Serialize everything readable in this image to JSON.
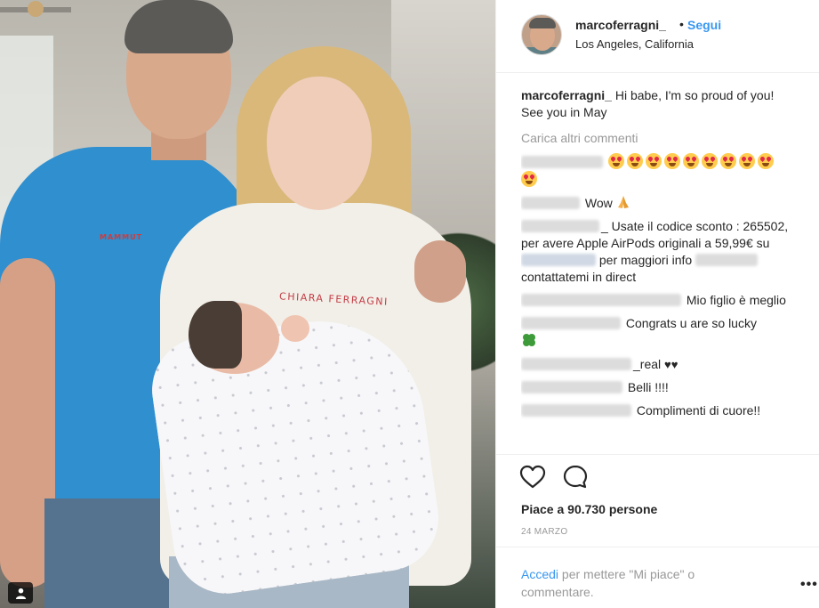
{
  "post": {
    "shirt_logo": "MAMMUT",
    "hoodie_text": "CHIARA FERRAGNI"
  },
  "header": {
    "username": "marcoferragni_",
    "separator": "•",
    "follow_label": "Segui",
    "location": "Los Angeles, California"
  },
  "caption": {
    "username": "marcoferragni_",
    "text": "Hi babe, I'm so proud of you! See you in May"
  },
  "load_more_label": "Carica altri commenti",
  "comments": [
    {
      "text": ""
    },
    {
      "text": "Wow"
    },
    {
      "text_a": "_ Usate il codice sconto : 265502, per avere Apple AirPods originali a 59,99€ su",
      "text_b": "per maggiori info",
      "text_c": "contattatemi in direct"
    },
    {
      "text": "Mio figlio è meglio"
    },
    {
      "text": "Congrats u are so lucky"
    },
    {
      "text": "_real"
    },
    {
      "text": "Belli !!!!"
    },
    {
      "text": "Complimenti di cuore!!"
    }
  ],
  "likes_label": "Piace a 90.730 persone",
  "date_label": "24 MARZO",
  "login": {
    "link_label": "Accedi",
    "rest": " per mettere \"Mi piace\" o commentare."
  },
  "more_label": "•••",
  "icons": {
    "heart": "heart-outline-icon",
    "comment": "speech-bubble-icon",
    "user_tag": "person-icon"
  },
  "colors": {
    "link_blue": "#3897f0",
    "text": "#262626",
    "muted": "#999999"
  }
}
